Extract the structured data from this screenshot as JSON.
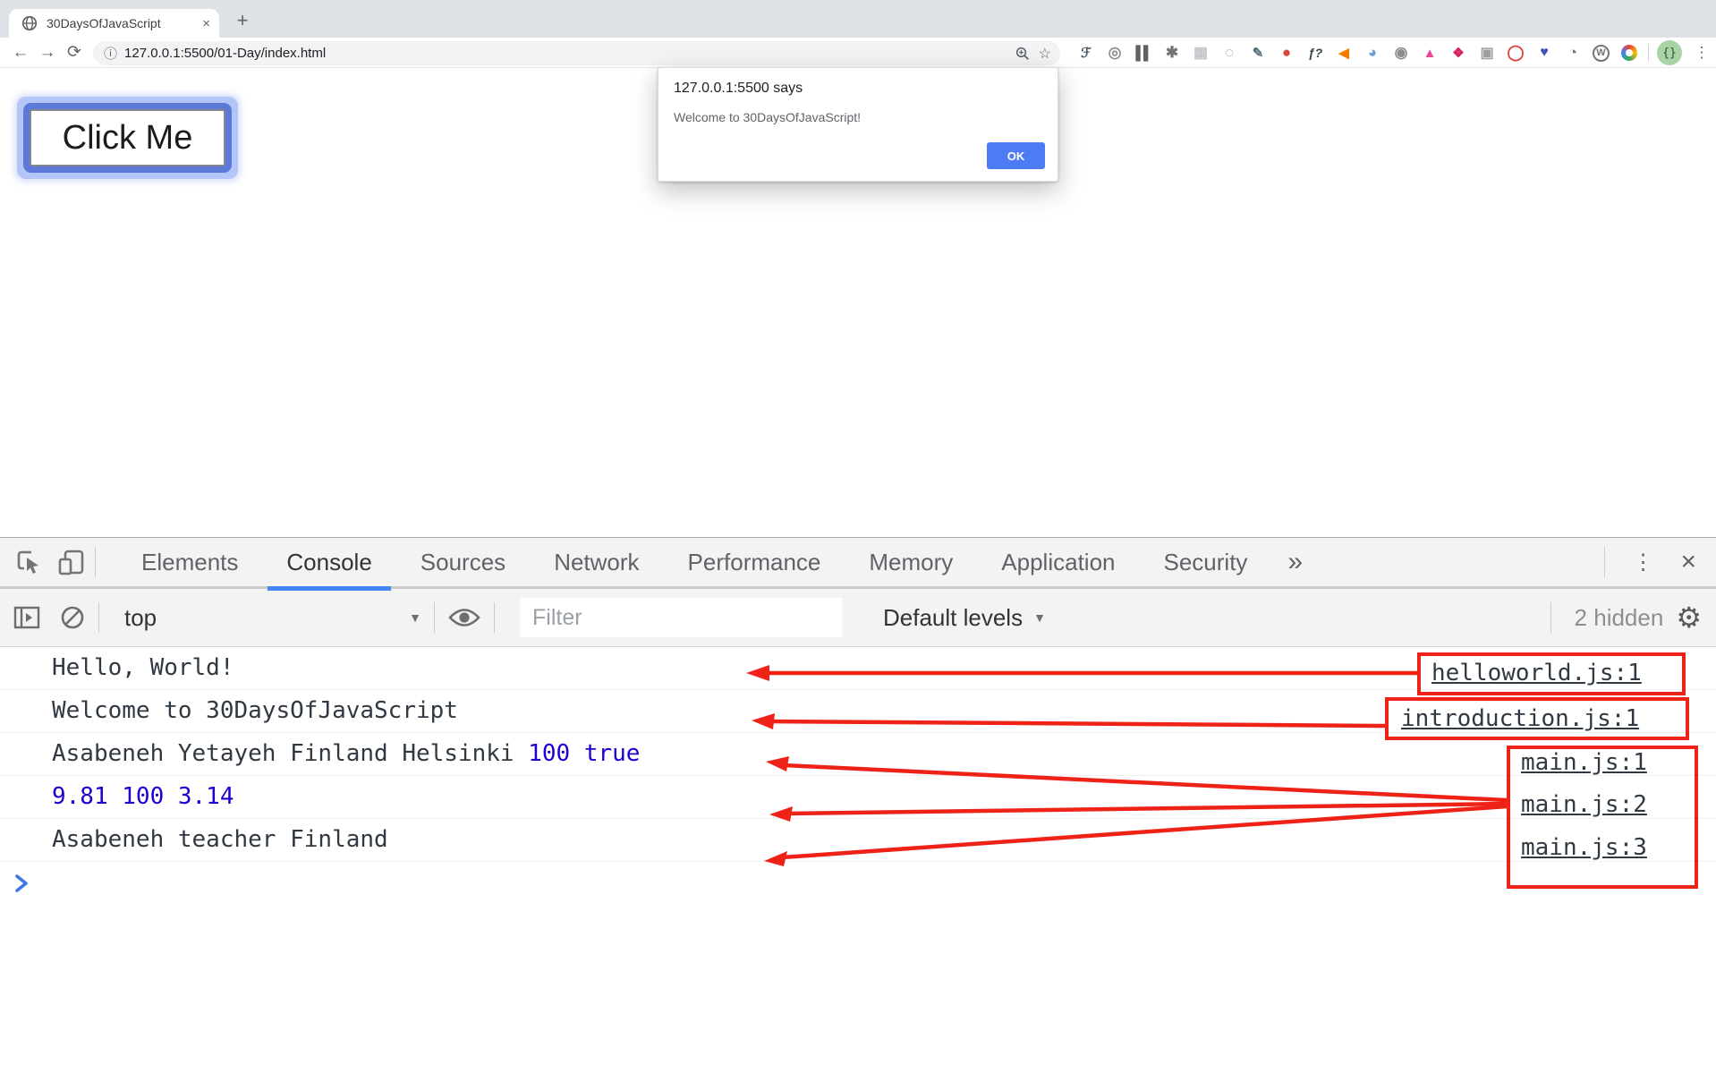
{
  "browser": {
    "tab": {
      "title": "30DaysOfJavaScript",
      "close_icon": "×"
    },
    "newtab_icon": "+",
    "nav": {
      "back_icon": "←",
      "forward_icon": "→",
      "reload_icon": "⟳"
    },
    "omnibox": {
      "info_icon": "ⓘ",
      "url": "127.0.0.1:5500/01-Day/index.html",
      "bookmark_icon": "☆"
    },
    "extensions": [
      {
        "name": "ext-script-f",
        "glyph": "ℱ"
      },
      {
        "name": "ext-circle-outline",
        "glyph": "◎"
      },
      {
        "name": "ext-pause-bars",
        "glyph": "▌▌"
      },
      {
        "name": "ext-bug",
        "glyph": "✱"
      },
      {
        "name": "ext-grid",
        "glyph": "▦"
      },
      {
        "name": "ext-dotted-circle",
        "glyph": "◌"
      },
      {
        "name": "ext-eyedropper",
        "glyph": "✎"
      },
      {
        "name": "ext-red-hand",
        "glyph": "●"
      },
      {
        "name": "ext-f-question",
        "glyph": "ƒ?"
      },
      {
        "name": "ext-megaphone",
        "glyph": "◀"
      },
      {
        "name": "ext-blue-sphere",
        "glyph": "◕"
      },
      {
        "name": "ext-camera",
        "glyph": "◉"
      },
      {
        "name": "ext-pink-bell",
        "glyph": "▲"
      },
      {
        "name": "ext-pink-flower",
        "glyph": "❖"
      },
      {
        "name": "ext-overlap-squares",
        "glyph": "▣"
      },
      {
        "name": "ext-red-o",
        "glyph": "◯"
      },
      {
        "name": "ext-heart-magnifier",
        "glyph": "♥"
      },
      {
        "name": "ext-g-circle",
        "glyph": "◔"
      },
      {
        "name": "ext-w-circle",
        "glyph": "W"
      },
      {
        "name": "ext-color-ring",
        "glyph": ""
      }
    ],
    "avatar_text": "{}",
    "menu_icon": "⋮"
  },
  "page": {
    "button_label": "Click Me"
  },
  "dialog": {
    "title": "127.0.0.1:5500 says",
    "message": "Welcome to 30DaysOfJavaScript!",
    "ok_label": "OK"
  },
  "devtools": {
    "tabs": [
      "Elements",
      "Console",
      "Sources",
      "Network",
      "Performance",
      "Memory",
      "Application",
      "Security"
    ],
    "active_tab": "Console",
    "more_tabs_icon": "»",
    "menu_icon": "⋮",
    "close_icon": "×",
    "toolbar": {
      "context": "top",
      "caret_icon": "▼",
      "filter_placeholder": "Filter",
      "levels_label": "Default levels",
      "hidden_count": "2 hidden",
      "gear_icon": "⚙"
    },
    "console": {
      "rows": [
        {
          "segments": [
            {
              "t": "Hello, World!"
            }
          ],
          "link": "helloworld.js:1"
        },
        {
          "segments": [
            {
              "t": "Welcome to 30DaysOfJavaScript"
            }
          ],
          "link": "introduction.js:1"
        },
        {
          "segments": [
            {
              "t": "Asabeneh Yetayeh Finland Helsinki "
            },
            {
              "t": "100 true"
            }
          ],
          "link": "main.js:1"
        },
        {
          "segments": [
            {
              "t": "9.81 100 3.14"
            }
          ],
          "link": "main.js:2"
        },
        {
          "segments": [
            {
              "t": "Asabeneh teacher Finland"
            }
          ],
          "link": "main.js:3"
        }
      ]
    }
  },
  "colors": {
    "accent_blue": "#4285f4",
    "number_blue": "#1c00cf",
    "annotation_red": "#ef2218",
    "ok_button_blue": "#4c7bf4",
    "console_text": "#303942"
  }
}
